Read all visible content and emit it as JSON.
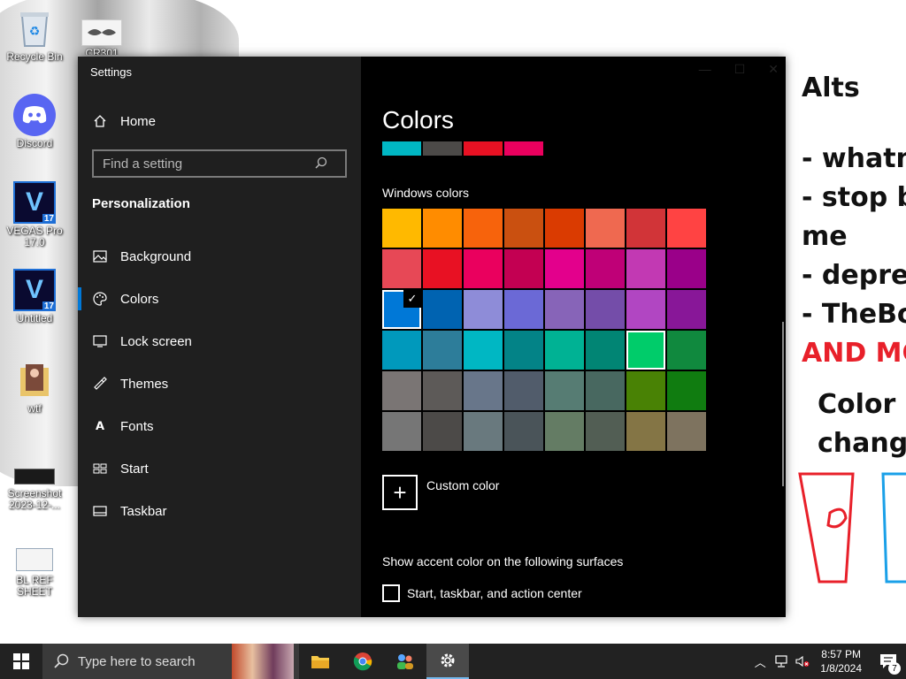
{
  "desktop": {
    "icons": [
      {
        "label": "Recycle Bin"
      },
      {
        "label": "CR301"
      },
      {
        "label": "Discord"
      },
      {
        "label": "VEGAS Pro 17.0"
      },
      {
        "label": "Untitled"
      },
      {
        "label": "wtf"
      },
      {
        "label": "Screenshot 2023-12-..."
      },
      {
        "label": "BL REF SHEET"
      }
    ],
    "vegas_version": "17",
    "vegas_letter": "V"
  },
  "doodle": {
    "lines": [
      "Alts",
      "- whatm",
      "- stop b",
      "me",
      "- depre",
      "- TheBo",
      "AND MC",
      "Color c",
      "change"
    ]
  },
  "settings": {
    "window_title": "Settings",
    "search_placeholder": "Find a setting",
    "section": "Personalization",
    "nav": [
      {
        "label": "Home",
        "icon": "home-icon"
      },
      {
        "label": "Background",
        "icon": "image-icon"
      },
      {
        "label": "Colors",
        "icon": "palette-icon",
        "active": true
      },
      {
        "label": "Lock screen",
        "icon": "monitor-icon"
      },
      {
        "label": "Themes",
        "icon": "brush-icon"
      },
      {
        "label": "Fonts",
        "icon": "font-icon"
      },
      {
        "label": "Start",
        "icon": "start-grid-icon"
      },
      {
        "label": "Taskbar",
        "icon": "taskbar-icon"
      }
    ],
    "page_title": "Colors",
    "recent_colors": [
      "#00b7c3",
      "#4c4a48",
      "#e81123",
      "#ea005e"
    ],
    "windows_colors_label": "Windows colors",
    "swatches": [
      "#ffb900",
      "#ff8c00",
      "#f7630c",
      "#ca5010",
      "#da3b01",
      "#ef6950",
      "#d13438",
      "#ff4343",
      "#e74856",
      "#e81123",
      "#ea005e",
      "#c30052",
      "#e3008c",
      "#bf0077",
      "#c239b3",
      "#9a0089",
      "#0078d7",
      "#0063b1",
      "#8e8cd8",
      "#6b69d6",
      "#8764b8",
      "#744da9",
      "#b146c2",
      "#881798",
      "#0099bc",
      "#2d7d9a",
      "#00b7c3",
      "#038387",
      "#00b294",
      "#018574",
      "#00cc6a",
      "#10893e",
      "#7a7574",
      "#5d5a58",
      "#68768a",
      "#515c6b",
      "#567c73",
      "#486860",
      "#498205",
      "#107c10",
      "#767676",
      "#4c4a48",
      "#69797e",
      "#4a5459",
      "#647c64",
      "#525e54",
      "#847545",
      "#7e735f"
    ],
    "selected_index": 16,
    "hover_index": 30,
    "custom_color_label": "Custom color",
    "accent_surfaces_label": "Show accent color on the following surfaces",
    "start_taskbar_label": "Start, taskbar, and action center"
  },
  "taskbar": {
    "search_placeholder": "Type here to search",
    "time": "8:57 PM",
    "date": "1/8/2024",
    "notification_count": "7"
  }
}
